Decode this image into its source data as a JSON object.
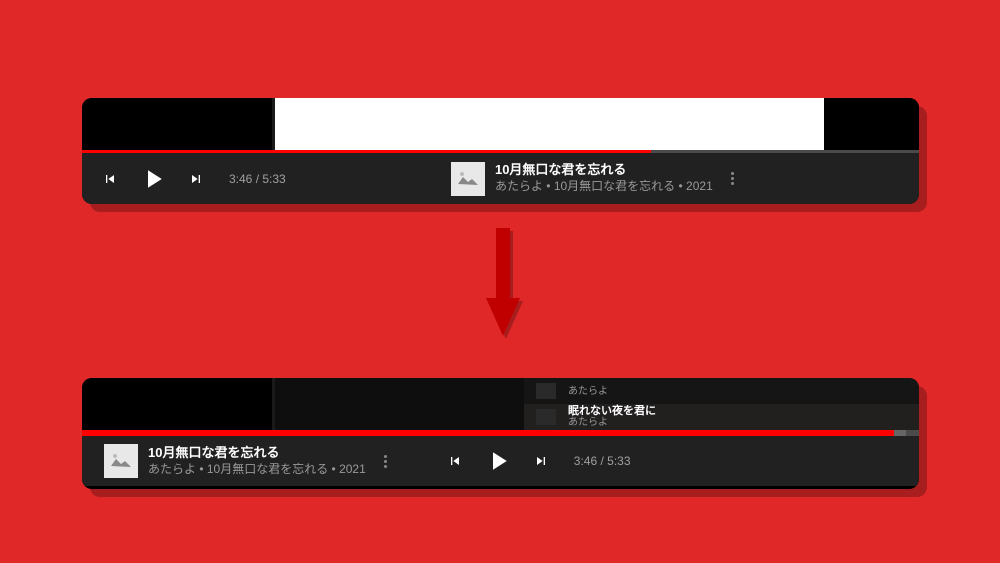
{
  "track": {
    "title": "10月無口な君を忘れる",
    "artist": "あたらよ",
    "album": "10月無口な君を忘れる",
    "year": "2021",
    "meta": "あたらよ • 10月無口な君を忘れる • 2021"
  },
  "time": {
    "current": "3:46",
    "duration": "5:33",
    "display": "3:46 / 5:33"
  },
  "queue": {
    "item1": {
      "artist": "あたらよ"
    },
    "item2": {
      "title": "眠れない夜を君に",
      "artist": "あたらよ"
    }
  },
  "colors": {
    "background": "#e02828",
    "progress": "#ff0000",
    "controlBar": "#212121"
  }
}
